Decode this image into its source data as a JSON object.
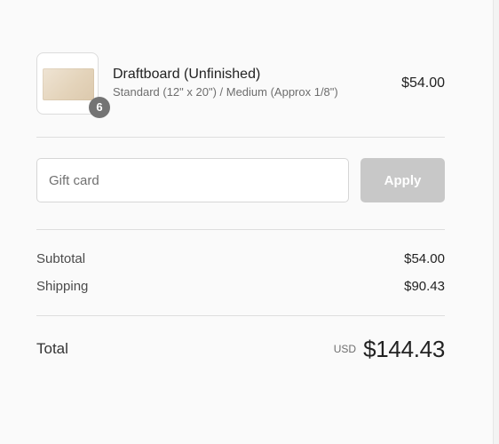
{
  "product": {
    "title": "Draftboard (Unfinished)",
    "variant": "Standard (12\" x 20\") / Medium (Approx 1/8\")",
    "price": "$54.00",
    "quantity": "6"
  },
  "gift_card": {
    "placeholder": "Gift card",
    "value": "",
    "apply_label": "Apply"
  },
  "totals": {
    "subtotal_label": "Subtotal",
    "subtotal_value": "$54.00",
    "shipping_label": "Shipping",
    "shipping_value": "$90.43",
    "total_label": "Total",
    "currency": "USD",
    "total_value": "$144.43"
  },
  "colors": {
    "background": "#fafafa",
    "badge": "#747474",
    "apply_disabled": "#c8c8c8",
    "divider": "#dedede"
  }
}
